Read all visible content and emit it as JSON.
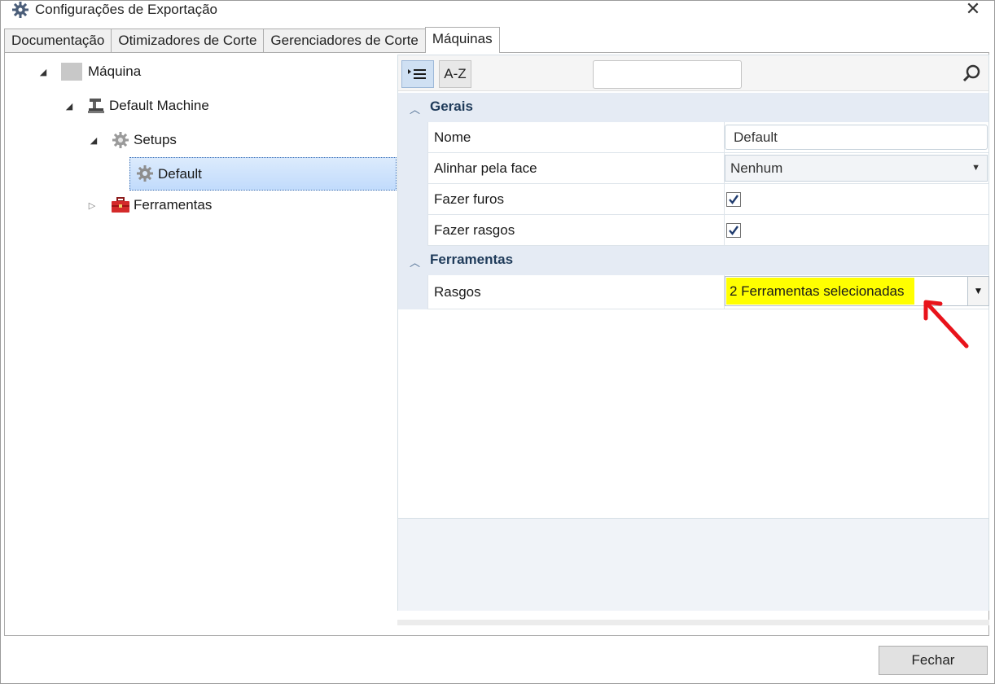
{
  "window": {
    "title": "Configurações de Exportação",
    "close_glyph": "✕",
    "icon": "gear-icon"
  },
  "tabs": [
    {
      "label": "Documentação",
      "active": false
    },
    {
      "label": "Otimizadores de Corte",
      "active": false
    },
    {
      "label": "Gerenciadores de Corte",
      "active": false
    },
    {
      "label": "Máquinas",
      "active": true
    }
  ],
  "tree": {
    "root": {
      "label": "Máquina",
      "expanded": true
    },
    "machine": {
      "label": "Default Machine",
      "icon": "machine-icon",
      "expanded": true
    },
    "setups": {
      "label": "Setups",
      "icon": "gear-icon",
      "expanded": true
    },
    "default_setup": {
      "label": "Default",
      "icon": "gear-icon",
      "selected": true
    },
    "tools": {
      "label": "Ferramentas",
      "icon": "toolbox-icon",
      "expanded": false
    }
  },
  "property_grid": {
    "toolbar": {
      "categorized_icon": "categorized-list-icon",
      "alpha_label": "A-Z",
      "search_value": "",
      "search_icon": "search-icon"
    },
    "categories": [
      {
        "label": "Gerais",
        "properties": [
          {
            "name": "Nome",
            "type": "text",
            "value": "Default"
          },
          {
            "name": "Alinhar pela face",
            "type": "combo",
            "value": "Nenhum"
          },
          {
            "name": "Fazer furos",
            "type": "checkbox",
            "checked": true
          },
          {
            "name": "Fazer rasgos",
            "type": "checkbox",
            "checked": true
          }
        ]
      },
      {
        "label": "Ferramentas",
        "properties": [
          {
            "name": "Rasgos",
            "type": "multiselect",
            "value": "2 Ferramentas selecionadas",
            "highlight": "#ffff00"
          }
        ]
      }
    ]
  },
  "footer": {
    "close_label": "Fechar"
  },
  "annotation": {
    "arrow_color": "#e8131b"
  }
}
